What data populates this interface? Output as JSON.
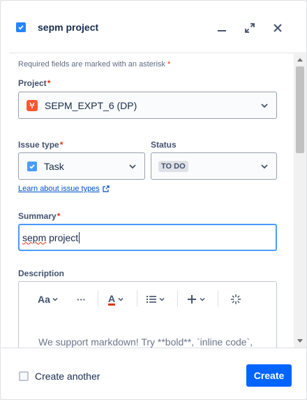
{
  "header": {
    "title": "sepm project",
    "icons": {
      "type": "checkbox-icon",
      "minimize": "minimize-icon",
      "expand": "expand-icon",
      "close": "close-icon"
    }
  },
  "form": {
    "required_note": "Required fields are marked with an asterisk",
    "required_star": "*",
    "project": {
      "label": "Project",
      "value": "SEPM_EXPT_6 (DP)"
    },
    "issue_type": {
      "label": "Issue type",
      "value": "Task"
    },
    "status": {
      "label": "Status",
      "value": "TO DO"
    },
    "learn_link": "Learn about issue types",
    "summary": {
      "label": "Summary",
      "value_underlined": "sepm",
      "value_rest": " project"
    },
    "description": {
      "label": "Description",
      "toolbar": [
        "text-style",
        "more",
        "text-color",
        "list",
        "insert",
        "ai"
      ],
      "text_style_label": "Aa",
      "text_color_label": "A",
      "more_label": "···",
      "placeholder": "We support markdown! Try **bold**, `inline code`,"
    }
  },
  "footer": {
    "create_another": "Create another",
    "create_button": "Create"
  },
  "colors": {
    "primary": "#0065ff",
    "required": "#de350b",
    "link": "#0052cc",
    "focus": "#4c9aff"
  }
}
